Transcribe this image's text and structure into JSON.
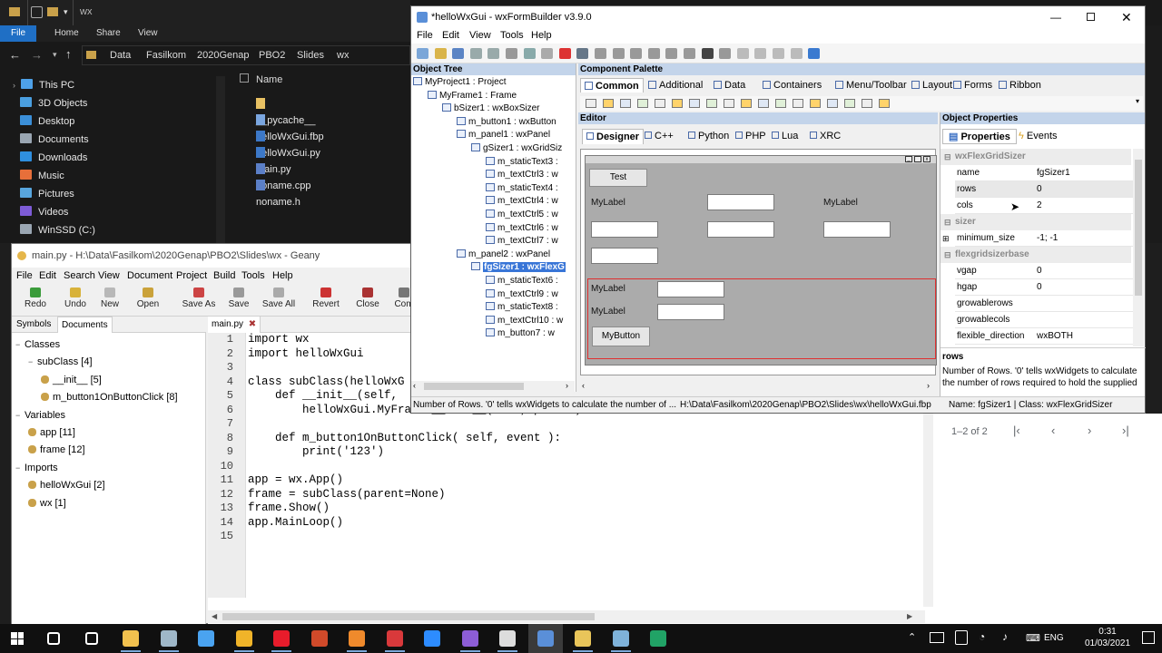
{
  "explorer": {
    "path": [
      "Data",
      "Fasilkom",
      "2020Genap",
      "PBO2",
      "Slides",
      "wx"
    ],
    "title_crumb": "wx",
    "ribbon_tabs": [
      "File",
      "Home",
      "Share",
      "View"
    ],
    "nav_items": [
      {
        "label": "This PC",
        "color": "#4ea1e8"
      },
      {
        "label": "3D Objects",
        "color": "#4a9fe0"
      },
      {
        "label": "Desktop",
        "color": "#3b8fd8"
      },
      {
        "label": "Documents",
        "color": "#9aa6b2"
      },
      {
        "label": "Downloads",
        "color": "#2f8fdf"
      },
      {
        "label": "Music",
        "color": "#e76f3a"
      },
      {
        "label": "Pictures",
        "color": "#58a6de"
      },
      {
        "label": "Videos",
        "color": "#7d5bd6"
      },
      {
        "label": "WinSSD (C:)",
        "color": "#9aa6b2"
      }
    ],
    "column_name": "Name",
    "files": [
      {
        "name": "__pycache__",
        "color": "#e8c163"
      },
      {
        "name": "helloWxGui.fbp",
        "color": "#7aa6e0"
      },
      {
        "name": "helloWxGui.py",
        "color": "#3c78c8"
      },
      {
        "name": "main.py",
        "color": "#3c78c8"
      },
      {
        "name": "noname.cpp",
        "color": "#5b7fc7"
      },
      {
        "name": "noname.h",
        "color": "#5b7fc7"
      }
    ]
  },
  "geany": {
    "title": "main.py - H:\\Data\\Fasilkom\\2020Genap\\PBO2\\Slides\\wx - Geany",
    "menu": [
      "File",
      "Edit",
      "Search",
      "View",
      "Document",
      "Project",
      "Build",
      "Tools",
      "Help"
    ],
    "toolbar": [
      "Redo",
      "Undo",
      "New",
      "Open",
      "Save As",
      "Save",
      "Save All",
      "Revert",
      "Close",
      "Com"
    ],
    "sidebar_tabs": [
      "Symbols",
      "Documents"
    ],
    "symbols": [
      {
        "text": "Classes",
        "indent": 0,
        "sign": "−"
      },
      {
        "text": "subClass [4]",
        "indent": 1,
        "sign": "−"
      },
      {
        "text": "__init__ [5]",
        "indent": 2,
        "sign": ""
      },
      {
        "text": "m_button1OnButtonClick [8]",
        "indent": 2,
        "sign": ""
      },
      {
        "text": "Variables",
        "indent": 0,
        "sign": "−"
      },
      {
        "text": "app [11]",
        "indent": 1,
        "sign": ""
      },
      {
        "text": "frame [12]",
        "indent": 1,
        "sign": ""
      },
      {
        "text": "Imports",
        "indent": 0,
        "sign": "−"
      },
      {
        "text": "helloWxGui [2]",
        "indent": 1,
        "sign": ""
      },
      {
        "text": "wx [1]",
        "indent": 1,
        "sign": ""
      }
    ],
    "editor_tab": "main.py",
    "code": [
      "import wx",
      "import helloWxGui",
      "",
      "class subClass(helloWxG",
      "    def __init__(self,",
      "        helloWxGui.MyFrame.__init__(self, parent)",
      "",
      "    def m_button1OnButtonClick( self, event ):",
      "        print('123')",
      "",
      "app = wx.App()",
      "frame = subClass(parent=None)",
      "frame.Show()",
      "app.MainLoop()",
      ""
    ]
  },
  "wxfb": {
    "title": "*helloWxGui - wxFormBuilder v3.9.0",
    "menu": [
      "File",
      "Edit",
      "View",
      "Tools",
      "Help"
    ],
    "object_tree_title": "Object Tree",
    "tree": [
      {
        "text": "MyProject1 : Project",
        "lvl": 0
      },
      {
        "text": "MyFrame1 : Frame",
        "lvl": 1
      },
      {
        "text": "bSizer1 : wxBoxSizer",
        "lvl": 2
      },
      {
        "text": "m_button1 : wxButton",
        "lvl": 3
      },
      {
        "text": "m_panel1 : wxPanel",
        "lvl": 3
      },
      {
        "text": "gSizer1 : wxGridSiz",
        "lvl": 4
      },
      {
        "text": "m_staticText3 :",
        "lvl": 5
      },
      {
        "text": "m_textCtrl3 : w",
        "lvl": 5
      },
      {
        "text": "m_staticText4 :",
        "lvl": 5
      },
      {
        "text": "m_textCtrl4 : w",
        "lvl": 5
      },
      {
        "text": "m_textCtrl5 : w",
        "lvl": 5
      },
      {
        "text": "m_textCtrl6 : w",
        "lvl": 5
      },
      {
        "text": "m_textCtrl7 : w",
        "lvl": 5
      },
      {
        "text": "m_panel2 : wxPanel",
        "lvl": 3
      },
      {
        "text": "fgSizer1 : wxFlexG",
        "lvl": 4,
        "selected": true
      },
      {
        "text": "m_staticText6 :",
        "lvl": 5
      },
      {
        "text": "m_textCtrl9 : w",
        "lvl": 5
      },
      {
        "text": "m_staticText8 :",
        "lvl": 5
      },
      {
        "text": "m_textCtrl10 : w",
        "lvl": 5
      },
      {
        "text": "m_button7 : w",
        "lvl": 5
      }
    ],
    "palette_title": "Component Palette",
    "palette_tabs": [
      "Common",
      "Additional",
      "Data",
      "Containers",
      "Menu/Toolbar",
      "Layout",
      "Forms",
      "Ribbon"
    ],
    "editor_title": "Editor",
    "editor_tabs": [
      "Designer",
      "C++",
      "Python",
      "PHP",
      "Lua",
      "XRC"
    ],
    "design": {
      "test_button": "Test",
      "label": "MyLabel",
      "bottom_button": "MyButton"
    },
    "props_title": "Object Properties",
    "props_tabs": [
      "Properties",
      "Events"
    ],
    "props": [
      {
        "cat": "wxFlexGridSizer"
      },
      {
        "k": "name",
        "v": "fgSizer1"
      },
      {
        "k": "rows",
        "v": "0"
      },
      {
        "k": "cols",
        "v": "2"
      },
      {
        "cat": "sizer"
      },
      {
        "k": "minimum_size",
        "v": "-1; -1",
        "plus": true
      },
      {
        "cat": "flexgridsizerbase"
      },
      {
        "k": "vgap",
        "v": "0"
      },
      {
        "k": "hgap",
        "v": "0"
      },
      {
        "k": "growablerows",
        "v": ""
      },
      {
        "k": "growablecols",
        "v": ""
      },
      {
        "k": "flexible_direction",
        "v": "wxBOTH"
      }
    ],
    "help_title": "rows",
    "help_text": "Number of Rows. '0' tells wxWidgets to calculate the number of rows required to hold the supplied",
    "status_left": "Number of Rows. '0' tells wxWidgets to calculate the number of ...",
    "status_mid": "H:\\Data\\Fasilkom\\2020Genap\\PBO2\\Slides\\wx\\helloWxGui.fbp",
    "status_right": "Name: fgSizer1 | Class: wxFlexGridSizer"
  },
  "mail": {
    "range": "1–2 of 2"
  },
  "taskbar": {
    "lang": "ENG",
    "time": "0:31",
    "date": "01/03/2021",
    "icons": [
      {
        "name": "search-icon",
        "color": "#ffffff"
      },
      {
        "name": "taskview-icon",
        "color": "#ffffff"
      },
      {
        "name": "explorer-icon",
        "color": "#f2c14e"
      },
      {
        "name": "edge-icon",
        "color": "#9fb7c8"
      },
      {
        "name": "settings-icon",
        "color": "#4aa3f0"
      },
      {
        "name": "chrome-icon",
        "color": "#f0b429"
      },
      {
        "name": "opera-icon",
        "color": "#e81c2b"
      },
      {
        "name": "powerpoint-icon",
        "color": "#d04a2a"
      },
      {
        "name": "app-orange-icon",
        "color": "#ef8a2c"
      },
      {
        "name": "app-red-icon",
        "color": "#d9393b"
      },
      {
        "name": "zoom-icon",
        "color": "#2d8cff"
      },
      {
        "name": "visualstudio-icon",
        "color": "#8d5dd6"
      },
      {
        "name": "github-icon",
        "color": "#dddddd"
      },
      {
        "name": "wxfb-icon",
        "color": "#5a8fd8"
      },
      {
        "name": "geany-icon",
        "color": "#e9c55a"
      },
      {
        "name": "app-blue-icon",
        "color": "#7fb2d9"
      },
      {
        "name": "excel-icon",
        "color": "#21a366"
      }
    ]
  }
}
